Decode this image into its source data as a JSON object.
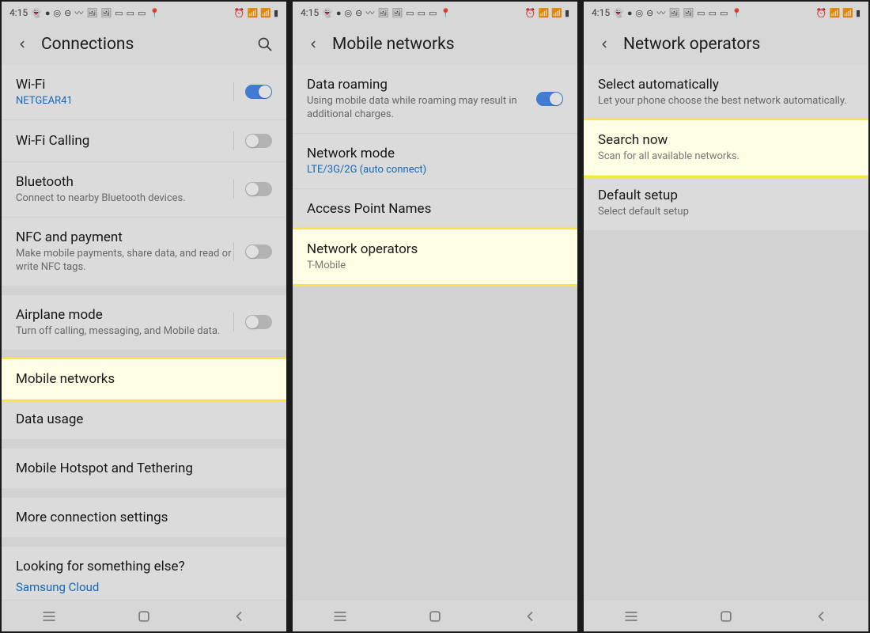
{
  "status": {
    "time": "4:15",
    "icons_left": [
      "👻",
      "●",
      "◎",
      "⊖",
      "〰",
      "🖼",
      "🖼",
      "▭",
      "▭",
      "▭",
      "📍"
    ],
    "icons_right": [
      "⏰",
      "📶",
      "📶",
      "▮"
    ]
  },
  "screens": [
    {
      "title": "Connections",
      "has_search": true,
      "groups": [
        {
          "rows": [
            {
              "title": "Wi-Fi",
              "sub": "NETGEAR41",
              "sub_blue": true,
              "toggle": true,
              "on": true
            },
            {
              "title": "Wi-Fi Calling",
              "toggle": true,
              "on": false
            },
            {
              "title": "Bluetooth",
              "sub": "Connect to nearby Bluetooth devices.",
              "toggle": true,
              "on": false
            },
            {
              "title": "NFC and payment",
              "sub": "Make mobile payments, share data, and read or write NFC tags.",
              "toggle": true,
              "on": false
            }
          ]
        },
        {
          "rows": [
            {
              "title": "Airplane mode",
              "sub": "Turn off calling, messaging, and Mobile data.",
              "toggle": true,
              "on": false
            }
          ]
        },
        {
          "rows": [
            {
              "title": "Mobile networks",
              "highlight": true
            },
            {
              "title": "Data usage"
            }
          ]
        },
        {
          "rows": [
            {
              "title": "Mobile Hotspot and Tethering"
            }
          ]
        },
        {
          "rows": [
            {
              "title": "More connection settings"
            }
          ]
        },
        {
          "rows": [
            {
              "title": "Looking for something else?",
              "link": "Samsung Cloud"
            }
          ]
        }
      ]
    },
    {
      "title": "Mobile networks",
      "has_search": false,
      "groups": [
        {
          "rows": [
            {
              "title": "Data roaming",
              "sub": "Using mobile data while roaming may result in additional charges.",
              "toggle": true,
              "on": true
            },
            {
              "title": "Network mode",
              "sub": "LTE/3G/2G (auto connect)",
              "sub_blue": true
            },
            {
              "title": "Access Point Names"
            },
            {
              "title": "Network operators",
              "sub": "T-Mobile",
              "highlight": true
            }
          ]
        }
      ]
    },
    {
      "title": "Network operators",
      "has_search": false,
      "groups": [
        {
          "rows": [
            {
              "title": "Select automatically",
              "sub": "Let your phone choose the best network automatically."
            },
            {
              "title": "Search now",
              "sub": "Scan for all available networks.",
              "highlight": true
            },
            {
              "title": "Default setup",
              "sub": "Select default setup"
            }
          ]
        }
      ]
    }
  ]
}
